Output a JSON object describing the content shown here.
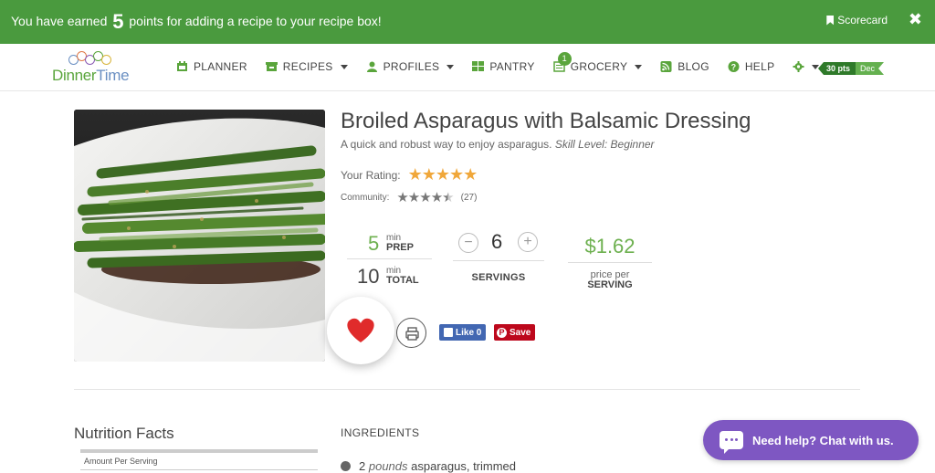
{
  "banner": {
    "message_prefix": "You have earned",
    "points": "5",
    "message_suffix": "points for adding a recipe to your recipe box!",
    "scorecard_label": "Scorecard",
    "close_glyph": "✖"
  },
  "brand": {
    "logo_part1": "Dinner",
    "logo_part2": "Time"
  },
  "nav": {
    "items": [
      {
        "label": "PLANNER",
        "icon": "calendar-icon"
      },
      {
        "label": "RECIPES",
        "icon": "recipe-box-icon",
        "dropdown": true
      },
      {
        "label": "PROFILES",
        "icon": "user-icon",
        "dropdown": true
      },
      {
        "label": "PANTRY",
        "icon": "grid-icon"
      },
      {
        "label": "GROCERY",
        "icon": "list-icon",
        "dropdown": true,
        "badge": "1"
      },
      {
        "label": "BLOG",
        "icon": "rss-icon"
      },
      {
        "label": "HELP",
        "icon": "question-icon"
      }
    ],
    "points_badge": {
      "points": "30 pts",
      "month": "Dec"
    }
  },
  "recipe": {
    "title": "Broiled Asparagus with Balsamic Dressing",
    "description": "A quick and robust way to enjoy asparagus.",
    "skill_level": "Skill Level: Beginner",
    "your_rating_label": "Your Rating:",
    "your_rating_stars": "★★★★★",
    "your_rating_value": 5,
    "community_label": "Community:",
    "community_stars": "★★★★★",
    "community_rating_value": 4.5,
    "community_count": "(27)",
    "prep": {
      "value": "5",
      "unit": "min",
      "label": "PREP"
    },
    "total": {
      "value": "10",
      "unit": "min",
      "label": "TOTAL"
    },
    "servings": {
      "minus": "−",
      "value": "6",
      "plus": "+",
      "label": "SERVINGS"
    },
    "price": {
      "value": "$1.62",
      "label1": "price per",
      "label2": "SERVING"
    },
    "facebook_like": "Like 0",
    "pinterest_save": "Save"
  },
  "nutrition": {
    "title": "Nutrition Facts",
    "amount_per_serving": "Amount Per Serving"
  },
  "ingredients": {
    "title": "INGREDIENTS",
    "items": [
      {
        "quantity": "2",
        "unit": "pounds",
        "name": "asparagus, trimmed"
      }
    ]
  },
  "chat": {
    "label": "Need help? Chat with us."
  },
  "colors": {
    "banner_green": "#4a9a3e",
    "accent_green": "#6db04f",
    "heart_red": "#e02b2b",
    "star_gold": "#f0a73a",
    "chat_purple": "#7e57c2"
  }
}
